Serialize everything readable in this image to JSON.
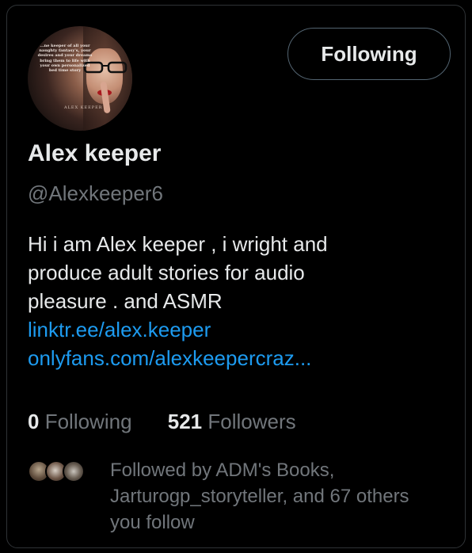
{
  "profile": {
    "avatar": {
      "blurb": "...ne keeper of all your naughty fantasy's, your desires and your dreams bring them to life with your own personalized bed time story",
      "brand": "ALEX KEEPER"
    },
    "follow_button_label": "Following",
    "name": "Alex keeper",
    "handle": "@Alexkeeper6",
    "bio_lines": [
      "Hi i am Alex keeper , i wright and",
      "produce adult stories for audio",
      "pleasure . and ASMR"
    ],
    "links": [
      "linktr.ee/alex.keeper",
      "onlyfans.com/alexkeepercraz..."
    ],
    "stats": {
      "following_count": "0",
      "following_label": "Following",
      "followers_count": "521",
      "followers_label": "Followers"
    },
    "followed_by_lines": [
      "Followed by ADM's Books,",
      "Jarturogp_storyteller, and 67 others",
      "you follow"
    ]
  },
  "colors": {
    "background": "#000000",
    "text_primary": "#e7e9ea",
    "text_secondary": "#71767b",
    "link": "#1d9bf0",
    "border": "#2f3336"
  }
}
